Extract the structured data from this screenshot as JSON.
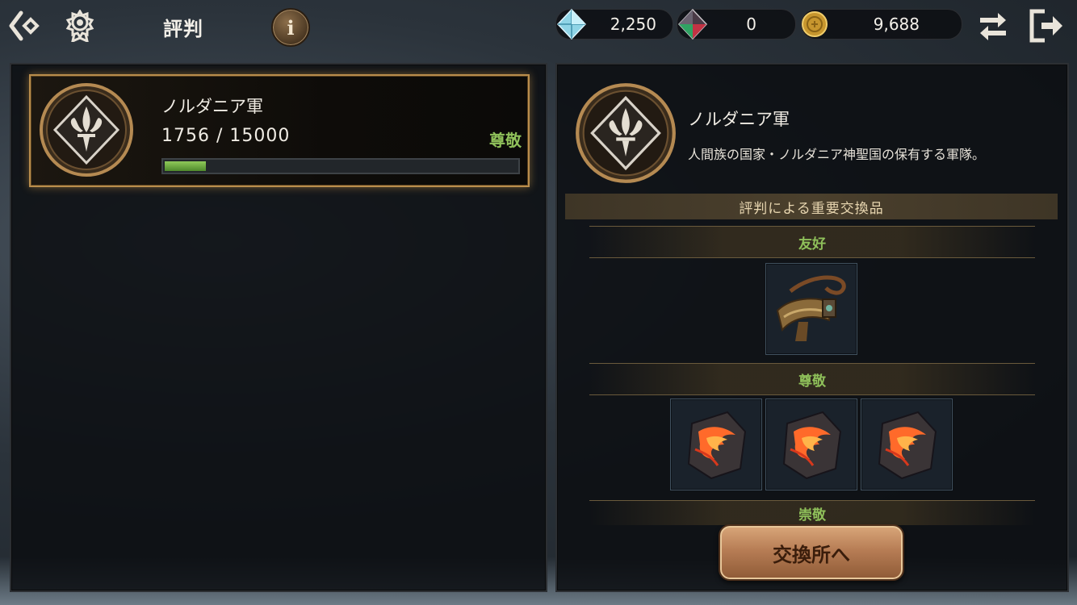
{
  "header": {
    "title": "評判",
    "info_label": "i",
    "currencies": [
      {
        "icon": "blue-crystal-icon",
        "value": "2,250"
      },
      {
        "icon": "red-green-crystal-icon",
        "value": "0"
      },
      {
        "icon": "gold-coin-icon",
        "value": "9,688"
      }
    ]
  },
  "faction_list": [
    {
      "name": "ノルダニア軍",
      "progress_text": "1756 / 15000",
      "current": 1756,
      "max": 15000,
      "rank": "尊敬"
    }
  ],
  "detail": {
    "name": "ノルダニア軍",
    "description": "人間族の国家・ノルダニア神聖国の保有する軍隊。",
    "section_title": "評判による重要交換品",
    "tiers": [
      {
        "label": "友好",
        "items": [
          "leather-belt-icon"
        ]
      },
      {
        "label": "尊敬",
        "items": [
          "fire-rune-stone-icon",
          "fire-rune-stone-icon",
          "fire-rune-stone-icon"
        ]
      },
      {
        "label": "崇敬",
        "items": []
      }
    ],
    "exchange_button": "交換所へ"
  },
  "colors": {
    "accent_gold": "#b98d4c",
    "rank_green": "#8fc05a",
    "button_bronze": "#b77d55"
  }
}
